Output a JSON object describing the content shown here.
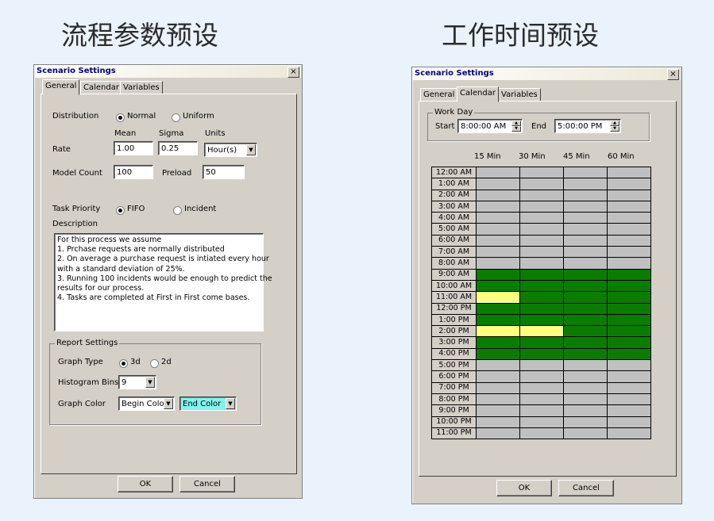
{
  "headings": {
    "left": "流程参数预设",
    "right": "工作时间预设"
  },
  "dialog_title": "Scenario Settings",
  "close_glyph": "×",
  "tabs": [
    "General",
    "Calendar",
    "Variables"
  ],
  "general": {
    "distribution": {
      "label": "Distribution",
      "options": [
        "Normal",
        "Uniform"
      ],
      "selected": "Normal"
    },
    "col_headers": {
      "mean": "Mean",
      "sigma": "Sigma",
      "units": "Units"
    },
    "rate": {
      "label": "Rate",
      "mean": "1.00",
      "sigma": "0.25",
      "units": "Hour(s)"
    },
    "model_count": {
      "label": "Model Count",
      "value": "100"
    },
    "preload": {
      "label": "Preload",
      "value": "50"
    },
    "task_priority": {
      "label": "Task Priority",
      "options": [
        "FIFO",
        "Incident"
      ],
      "selected": "FIFO"
    },
    "description": {
      "label": "Description",
      "lines": [
        "For this process we assume",
        "1. Prchase requests are normally distributed",
        "2. On average a purchase request is intiated every hour",
        "with a standard deviation of 25%.",
        "3. Running 100 incidents would be enough to predict the",
        "results for our process.",
        "4. Tasks are completed at First in First come bases."
      ]
    },
    "report_settings": {
      "label": "Report Settings",
      "graph_type": {
        "label": "Graph Type",
        "options": [
          "3d",
          "2d"
        ],
        "selected": "3d"
      },
      "histogram_bins": {
        "label": "Histogram Bins",
        "value": "9"
      },
      "graph_color": {
        "label": "Graph Color",
        "begin": "Begin Color",
        "end": "End Color",
        "end_color": "#7ff5ee"
      }
    }
  },
  "calendar": {
    "work_day": {
      "label": "Work Day",
      "start_label": "Start",
      "start": "8:00:00 AM",
      "end_label": "End",
      "end": "5:00:00 PM"
    },
    "columns": [
      "15 Min",
      "30 Min",
      "45 Min",
      "60 Min"
    ],
    "colors": {
      "working": "#0a7d00",
      "off": "#c0c0c0",
      "highlight": "#ffff80"
    },
    "rows": [
      {
        "time": "12:00 AM",
        "cells": [
          "off",
          "off",
          "off",
          "off"
        ]
      },
      {
        "time": "1:00 AM",
        "cells": [
          "off",
          "off",
          "off",
          "off"
        ]
      },
      {
        "time": "2:00 AM",
        "cells": [
          "off",
          "off",
          "off",
          "off"
        ]
      },
      {
        "time": "3:00 AM",
        "cells": [
          "off",
          "off",
          "off",
          "off"
        ]
      },
      {
        "time": "4:00 AM",
        "cells": [
          "off",
          "off",
          "off",
          "off"
        ]
      },
      {
        "time": "5:00 AM",
        "cells": [
          "off",
          "off",
          "off",
          "off"
        ]
      },
      {
        "time": "6:00 AM",
        "cells": [
          "off",
          "off",
          "off",
          "off"
        ]
      },
      {
        "time": "7:00 AM",
        "cells": [
          "off",
          "off",
          "off",
          "off"
        ]
      },
      {
        "time": "8:00 AM",
        "cells": [
          "off",
          "off",
          "off",
          "off"
        ]
      },
      {
        "time": "9:00 AM",
        "cells": [
          "working",
          "working",
          "working",
          "working"
        ]
      },
      {
        "time": "10:00 AM",
        "cells": [
          "working",
          "working",
          "working",
          "working"
        ]
      },
      {
        "time": "11:00 AM",
        "cells": [
          "highlight",
          "working",
          "working",
          "working"
        ]
      },
      {
        "time": "12:00 PM",
        "cells": [
          "working",
          "working",
          "working",
          "working"
        ]
      },
      {
        "time": "1:00 PM",
        "cells": [
          "working",
          "working",
          "working",
          "working"
        ]
      },
      {
        "time": "2:00 PM",
        "cells": [
          "highlight",
          "highlight",
          "working",
          "working"
        ]
      },
      {
        "time": "3:00 PM",
        "cells": [
          "working",
          "working",
          "working",
          "working"
        ]
      },
      {
        "time": "4:00 PM",
        "cells": [
          "working",
          "working",
          "working",
          "working"
        ]
      },
      {
        "time": "5:00 PM",
        "cells": [
          "off",
          "off",
          "off",
          "off"
        ]
      },
      {
        "time": "6:00 PM",
        "cells": [
          "off",
          "off",
          "off",
          "off"
        ]
      },
      {
        "time": "7:00 PM",
        "cells": [
          "off",
          "off",
          "off",
          "off"
        ]
      },
      {
        "time": "8:00 PM",
        "cells": [
          "off",
          "off",
          "off",
          "off"
        ]
      },
      {
        "time": "9:00 PM",
        "cells": [
          "off",
          "off",
          "off",
          "off"
        ]
      },
      {
        "time": "10:00 PM",
        "cells": [
          "off",
          "off",
          "off",
          "off"
        ]
      },
      {
        "time": "11:00 PM",
        "cells": [
          "off",
          "off",
          "off",
          "off"
        ]
      }
    ]
  },
  "buttons": {
    "ok": "OK",
    "cancel": "Cancel"
  }
}
